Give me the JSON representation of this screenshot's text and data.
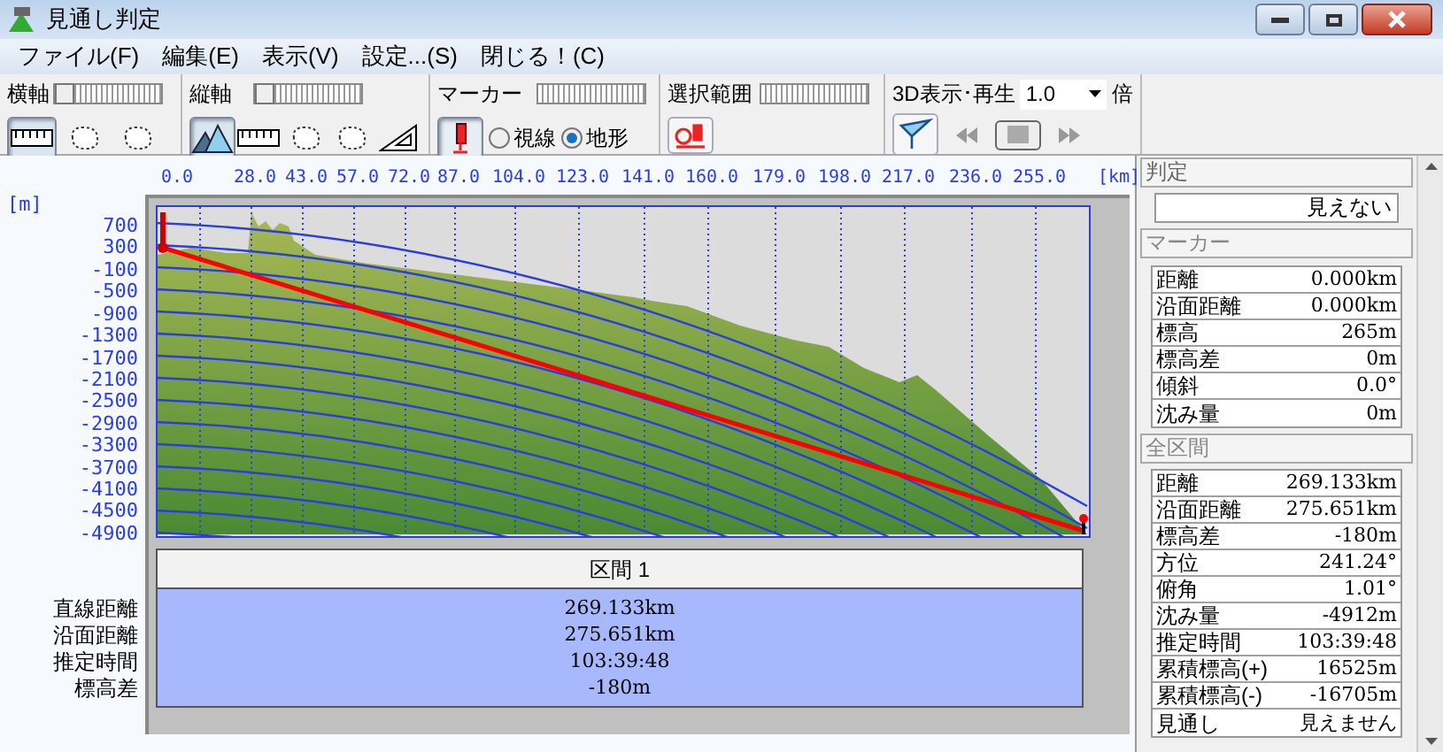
{
  "window": {
    "title": "見通し判定"
  },
  "menu": [
    "ファイル(F)",
    "編集(E)",
    "表示(V)",
    "設定...(S)",
    "閉じる！(C)"
  ],
  "toolbar": {
    "horizontal_axis": {
      "label": "横軸",
      "slider": {
        "level": 0
      },
      "buttons": [
        {
          "kind": "ruler",
          "selected": true
        },
        {
          "kind": "blob",
          "selected": false
        },
        {
          "kind": "blob",
          "selected": false
        }
      ]
    },
    "vertical_axis": {
      "label": "縦軸",
      "slider": {
        "level": 0
      },
      "buttons": [
        {
          "kind": "mountains",
          "selected": true
        },
        {
          "kind": "ruler",
          "selected": false
        },
        {
          "kind": "blob",
          "selected": false
        },
        {
          "kind": "blob",
          "selected": false
        },
        {
          "kind": "triangle",
          "selected": false
        }
      ]
    },
    "marker": {
      "label": "マーカー",
      "button_selected": true,
      "radios": [
        {
          "label": "視線",
          "selected": false
        },
        {
          "label": "地形",
          "selected": true
        }
      ]
    },
    "range": {
      "label": "選択範囲"
    },
    "playback": {
      "label": "3D表示･再生",
      "speed": "1.0",
      "unit": "倍",
      "controls": [
        {
          "kind": "prev"
        },
        {
          "kind": "stop"
        },
        {
          "kind": "next"
        }
      ]
    }
  },
  "profile": {
    "unit_y": "[m]",
    "unit_x": "[km]",
    "x_labels": [
      "0.0",
      "28.0",
      "43.0",
      "57.0",
      "72.0",
      "87.0",
      "104.0",
      "123.0",
      "141.0",
      "160.0",
      "179.0",
      "198.0",
      "217.0",
      "236.0",
      "255.0"
    ],
    "y_labels": [
      "700",
      "300",
      "-100",
      "-500",
      "-900",
      "-1300",
      "-1700",
      "-2100",
      "-2500",
      "-2900",
      "-3300",
      "-3700",
      "-4100",
      "-4500",
      "-4900"
    ]
  },
  "section": {
    "header": "区間 1",
    "rows": [
      {
        "label": "直線距離",
        "value": "269.133km"
      },
      {
        "label": "沿面距離",
        "value": "275.651km"
      },
      {
        "label": "推定時間",
        "value": "103:39:48"
      },
      {
        "label": "標高差",
        "value": "-180m"
      }
    ]
  },
  "judgement": {
    "title": "判定",
    "result": "見えない"
  },
  "marker_info": {
    "title": "マーカー",
    "rows": [
      {
        "label": "距離",
        "value": "0.000km"
      },
      {
        "label": "沿面距離",
        "value": "0.000km"
      },
      {
        "label": "標高",
        "value": "265m"
      },
      {
        "label": "標高差",
        "value": "0m"
      },
      {
        "label": "傾斜",
        "value": "0.0°"
      },
      {
        "label": "沈み量",
        "value": "0m"
      }
    ]
  },
  "whole": {
    "title": "全区間",
    "rows": [
      {
        "label": "距離",
        "value": "269.133km"
      },
      {
        "label": "沿面距離",
        "value": "275.651km"
      },
      {
        "label": "標高差",
        "value": "-180m"
      },
      {
        "label": "方位",
        "value": "241.24°"
      },
      {
        "label": "俯角",
        "value": "1.01°"
      },
      {
        "label": "沈み量",
        "value": "-4912m"
      },
      {
        "label": "推定時間",
        "value": "103:39:48"
      },
      {
        "label": "累積標高(+)",
        "value": "16525m"
      },
      {
        "label": "累積標高(-)",
        "value": "-16705m"
      },
      {
        "label": "見通し",
        "value": "見えません"
      }
    ]
  }
}
